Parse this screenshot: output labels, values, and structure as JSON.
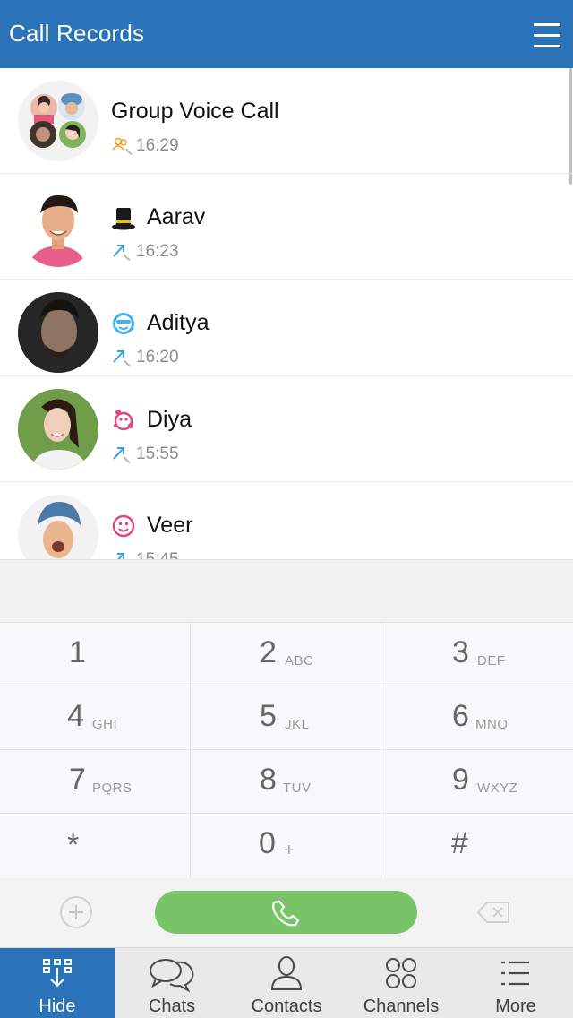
{
  "header": {
    "title": "Call Records"
  },
  "calls": [
    {
      "name": "Group Voice Call",
      "time": "16:29",
      "type": "group"
    },
    {
      "name": "Aarav",
      "time": "16:23",
      "type": "outgoing",
      "status_icon": "top-hat-icon"
    },
    {
      "name": "Aditya",
      "time": "16:20",
      "type": "outgoing",
      "status_icon": "sunglasses-smiley-icon"
    },
    {
      "name": "Diya",
      "time": "15:55",
      "type": "outgoing",
      "status_icon": "pink-flower-smiley-icon"
    },
    {
      "name": "Veer",
      "time": "15:45",
      "type": "outgoing",
      "status_icon": "pink-smiley-icon"
    }
  ],
  "keypad": [
    {
      "digit": "1",
      "letters": ""
    },
    {
      "digit": "2",
      "letters": "ABC"
    },
    {
      "digit": "3",
      "letters": "DEF"
    },
    {
      "digit": "4",
      "letters": "GHI"
    },
    {
      "digit": "5",
      "letters": "JKL"
    },
    {
      "digit": "6",
      "letters": "MNO"
    },
    {
      "digit": "7",
      "letters": "PQRS"
    },
    {
      "digit": "8",
      "letters": "TUV"
    },
    {
      "digit": "9",
      "letters": "WXYZ"
    },
    {
      "digit": "*",
      "letters": ""
    },
    {
      "digit": "0",
      "letters": "+"
    },
    {
      "digit": "#",
      "letters": ""
    }
  ],
  "tabs": [
    {
      "label": "Hide",
      "icon": "hide-keypad-icon",
      "active": true
    },
    {
      "label": "Chats",
      "icon": "chat-bubbles-icon",
      "active": false
    },
    {
      "label": "Contacts",
      "icon": "person-icon",
      "active": false
    },
    {
      "label": "Channels",
      "icon": "circles-grid-icon",
      "active": false
    },
    {
      "label": "More",
      "icon": "list-icon",
      "active": false
    }
  ],
  "colors": {
    "brand": "#2a73b9",
    "call_button": "#78c468",
    "outgoing_arrow": "#3aa0d8",
    "group_icon": "#f0a020"
  }
}
